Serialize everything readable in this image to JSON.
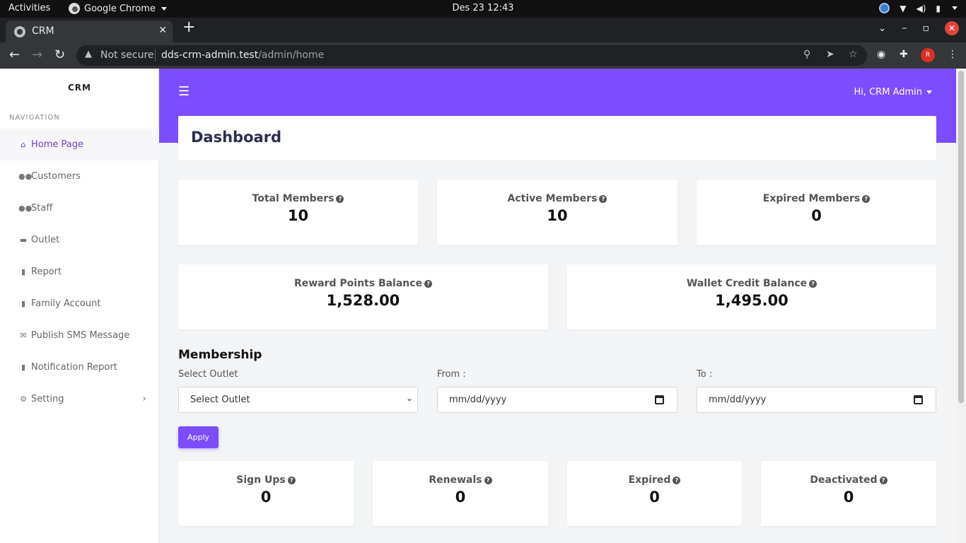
{
  "os_bar": {
    "activities": "Activities",
    "app_name": "Google Chrome",
    "clock": "Des 23  12:43"
  },
  "browser": {
    "tab_title": "CRM",
    "new_tab": "+",
    "security_label": "Not secure",
    "url_host": "dds-crm-admin.test",
    "url_path": "/admin/home",
    "profile_initial": "R"
  },
  "sidebar": {
    "brand": "CRM",
    "nav_caption": "NAVIGATION",
    "items": [
      {
        "label": "Home Page",
        "icon": "home-icon"
      },
      {
        "label": "Customers",
        "icon": "users-icon"
      },
      {
        "label": "Staff",
        "icon": "users-icon"
      },
      {
        "label": "Outlet",
        "icon": "store-icon"
      },
      {
        "label": "Report",
        "icon": "file-icon"
      },
      {
        "label": "Family Account",
        "icon": "file-icon"
      },
      {
        "label": "Publish SMS Message",
        "icon": "envelope-icon"
      },
      {
        "label": "Notification Report",
        "icon": "file-icon"
      },
      {
        "label": "Setting",
        "icon": "gear-icon"
      }
    ]
  },
  "header": {
    "user_greeting": "Hi, CRM Admin"
  },
  "page": {
    "title": "Dashboard"
  },
  "stats_top": [
    {
      "label": "Total Members",
      "value": "10"
    },
    {
      "label": "Active Members",
      "value": "10"
    },
    {
      "label": "Expired Members",
      "value": "0"
    }
  ],
  "stats_balance": [
    {
      "label": "Reward Points Balance",
      "value": "1,528.00"
    },
    {
      "label": "Wallet Credit Balance",
      "value": "1,495.00"
    }
  ],
  "membership": {
    "title": "Membership",
    "outlet_label": "Select Outlet",
    "outlet_value": "Select Outlet",
    "from_label": "From :",
    "from_placeholder": "mm/dd/yyyy",
    "to_label": "To :",
    "to_placeholder": "mm/dd/yyyy",
    "apply_label": "Apply"
  },
  "stats_membership": [
    {
      "label": "Sign Ups",
      "value": "0"
    },
    {
      "label": "Renewals",
      "value": "0"
    },
    {
      "label": "Expired",
      "value": "0"
    },
    {
      "label": "Deactivated",
      "value": "0"
    }
  ],
  "colors": {
    "accent": "#7c4dff",
    "active_nav": "#6f42c1"
  }
}
